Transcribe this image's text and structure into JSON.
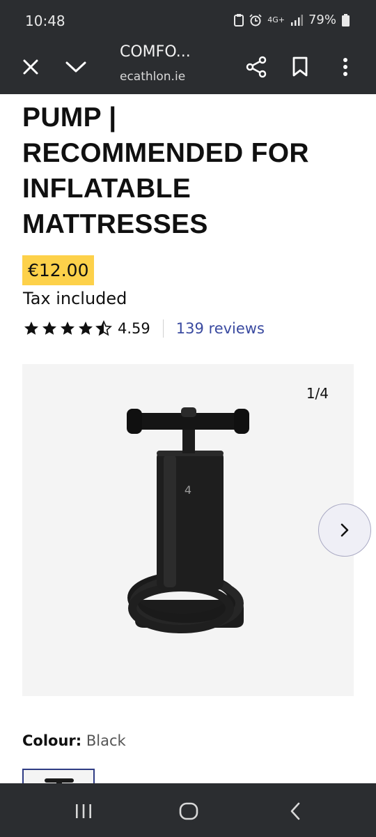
{
  "status_bar": {
    "time": "10:48",
    "network": "4G+",
    "battery": "79%"
  },
  "browser": {
    "page_title": "COMFO...",
    "url": "ecathlon.ie"
  },
  "product": {
    "title_lines": [
      "PUMP |",
      "RECOMMENDED FOR",
      "INFLATABLE",
      "MATTRESSES"
    ],
    "price": "€12.00",
    "tax_note": "Tax included",
    "rating": 4.59,
    "rating_text": "4.59",
    "reviews": "139 reviews"
  },
  "gallery": {
    "counter": "1/4"
  },
  "colour": {
    "label": "Colour:",
    "value": "Black"
  },
  "colors": {
    "chrome": "#2b2d30",
    "price_highlight": "#fdd14a",
    "link": "#3a4aa0"
  }
}
